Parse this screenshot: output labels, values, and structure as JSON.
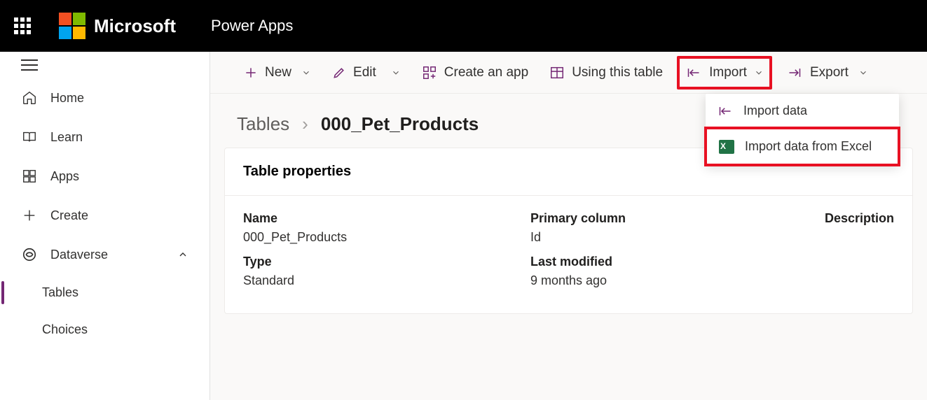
{
  "header": {
    "brand": "Microsoft",
    "app": "Power Apps"
  },
  "sidebar": {
    "items": [
      {
        "label": "Home"
      },
      {
        "label": "Learn"
      },
      {
        "label": "Apps"
      },
      {
        "label": "Create"
      },
      {
        "label": "Dataverse"
      },
      {
        "label": "Tables"
      },
      {
        "label": "Choices"
      }
    ]
  },
  "toolbar": {
    "new": "New",
    "edit": "Edit",
    "create_app": "Create an app",
    "using_table": "Using this table",
    "import": "Import",
    "export": "Export"
  },
  "dropdown": {
    "import_data": "Import data",
    "import_excel": "Import data from Excel"
  },
  "breadcrumb": {
    "root": "Tables",
    "current": "000_Pet_Products"
  },
  "card": {
    "title": "Table properties",
    "labels": {
      "name": "Name",
      "primary": "Primary column",
      "description": "Description",
      "type": "Type",
      "modified": "Last modified"
    },
    "values": {
      "name": "000_Pet_Products",
      "primary": "Id",
      "type": "Standard",
      "modified": "9 months ago"
    }
  }
}
